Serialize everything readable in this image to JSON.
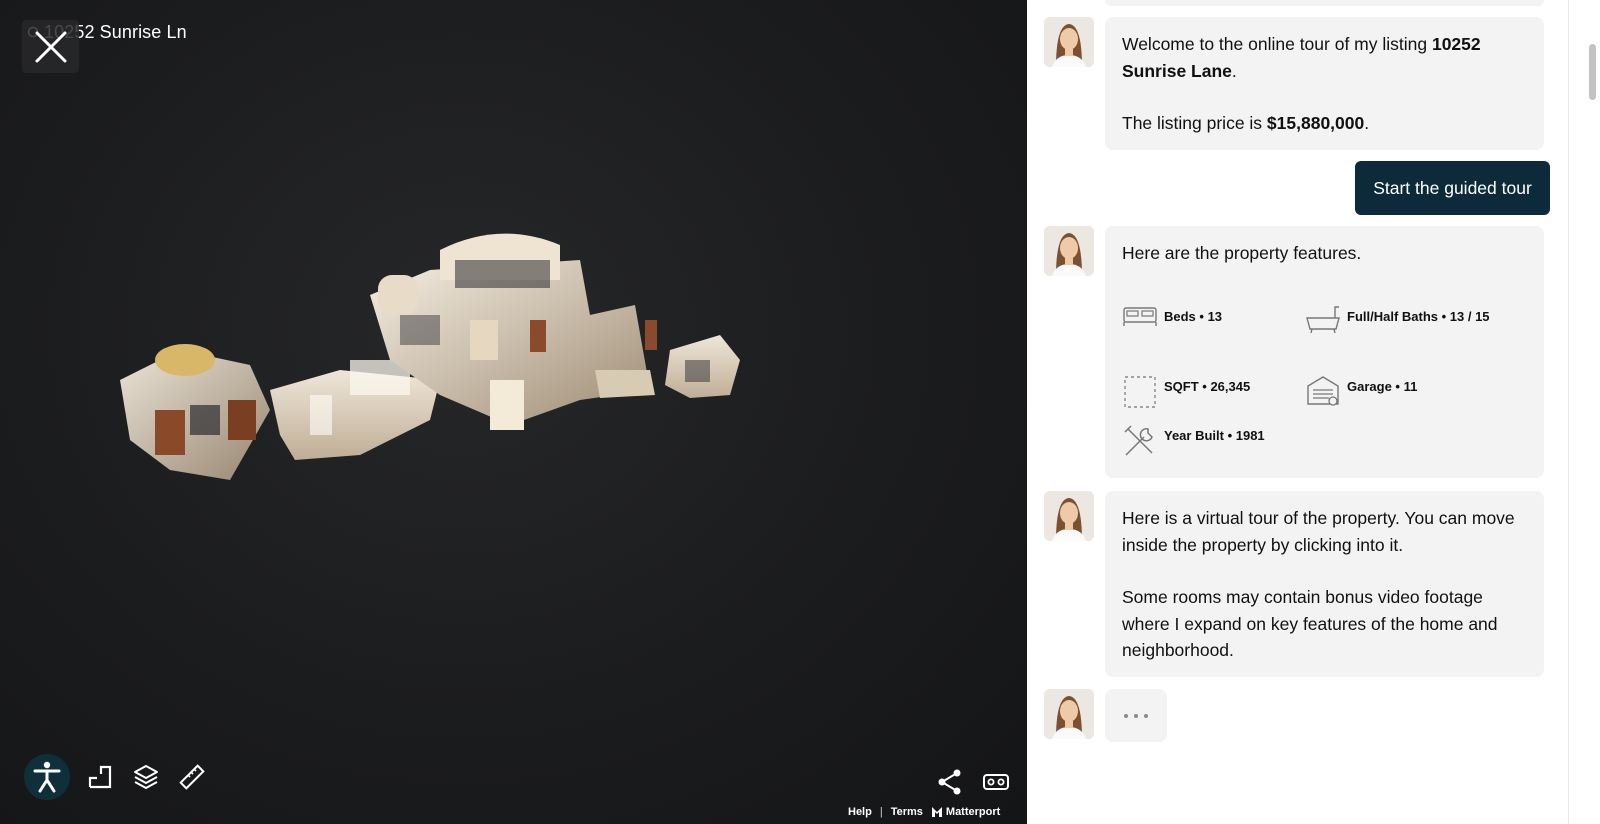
{
  "viewer": {
    "address": "10252 Sunrise Ln",
    "footer": {
      "help": "Help",
      "terms": "Terms",
      "brand": "Matterport",
      "separator": "|"
    }
  },
  "chat": {
    "messages": [
      {
        "pre1": "Welcome to the online tour of my listing ",
        "bold1": "10252 Sunrise Lane",
        "post1": ".",
        "pre2": "The listing price is ",
        "bold2": "$15,880,000",
        "post2": "."
      },
      {
        "text": "Here are the property features."
      },
      {
        "p1": "Here is a virtual tour of the property. You can move inside the property by clicking into it.",
        "p2": "Some rooms may contain bonus video footage where I expand on key features of the home and neighborhood."
      }
    ],
    "cta_label": "Start the guided tour",
    "features": {
      "beds": "Beds • 13",
      "baths": "Full/Half Baths • 13 / 15",
      "sqft": "SQFT • 26,345",
      "garage": "Garage • 11",
      "year": "Year Built • 1981"
    },
    "typing_indicator": "..."
  },
  "colors": {
    "cta_bg": "#0d2a3a",
    "bubble_bg": "#f3f3f3",
    "viewer_bg": "#1c1d1f",
    "a11y_bg": "#0f2f3a"
  },
  "icons": [
    "close-icon",
    "map-pin-icon",
    "accessibility-icon",
    "floorplan-icon",
    "layers-icon",
    "ruler-icon",
    "share-icon",
    "vr-icon",
    "bed-icon",
    "bathtub-icon",
    "area-icon",
    "garage-icon",
    "tools-icon",
    "matterport-logo-icon"
  ]
}
